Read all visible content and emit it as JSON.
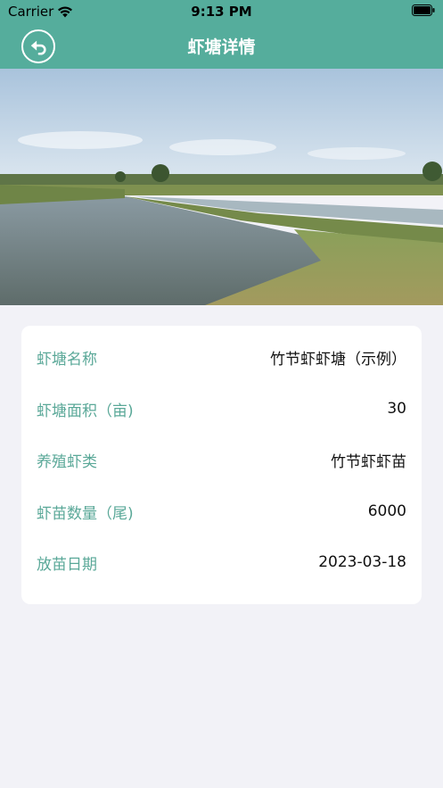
{
  "status_bar": {
    "carrier": "Carrier",
    "time": "9:13 PM"
  },
  "header": {
    "title": "虾塘详情",
    "back_icon": "back-arrow-icon",
    "color": "#55ad9c"
  },
  "details": [
    {
      "label": "虾塘名称",
      "value": "竹节虾虾塘（示例）"
    },
    {
      "label": "虾塘面积（亩)",
      "value": "30"
    },
    {
      "label": "养殖虾类",
      "value": "竹节虾虾苗"
    },
    {
      "label": "虾苗数量（尾)",
      "value": "6000"
    },
    {
      "label": "放苗日期",
      "value": "2023-03-18"
    }
  ]
}
